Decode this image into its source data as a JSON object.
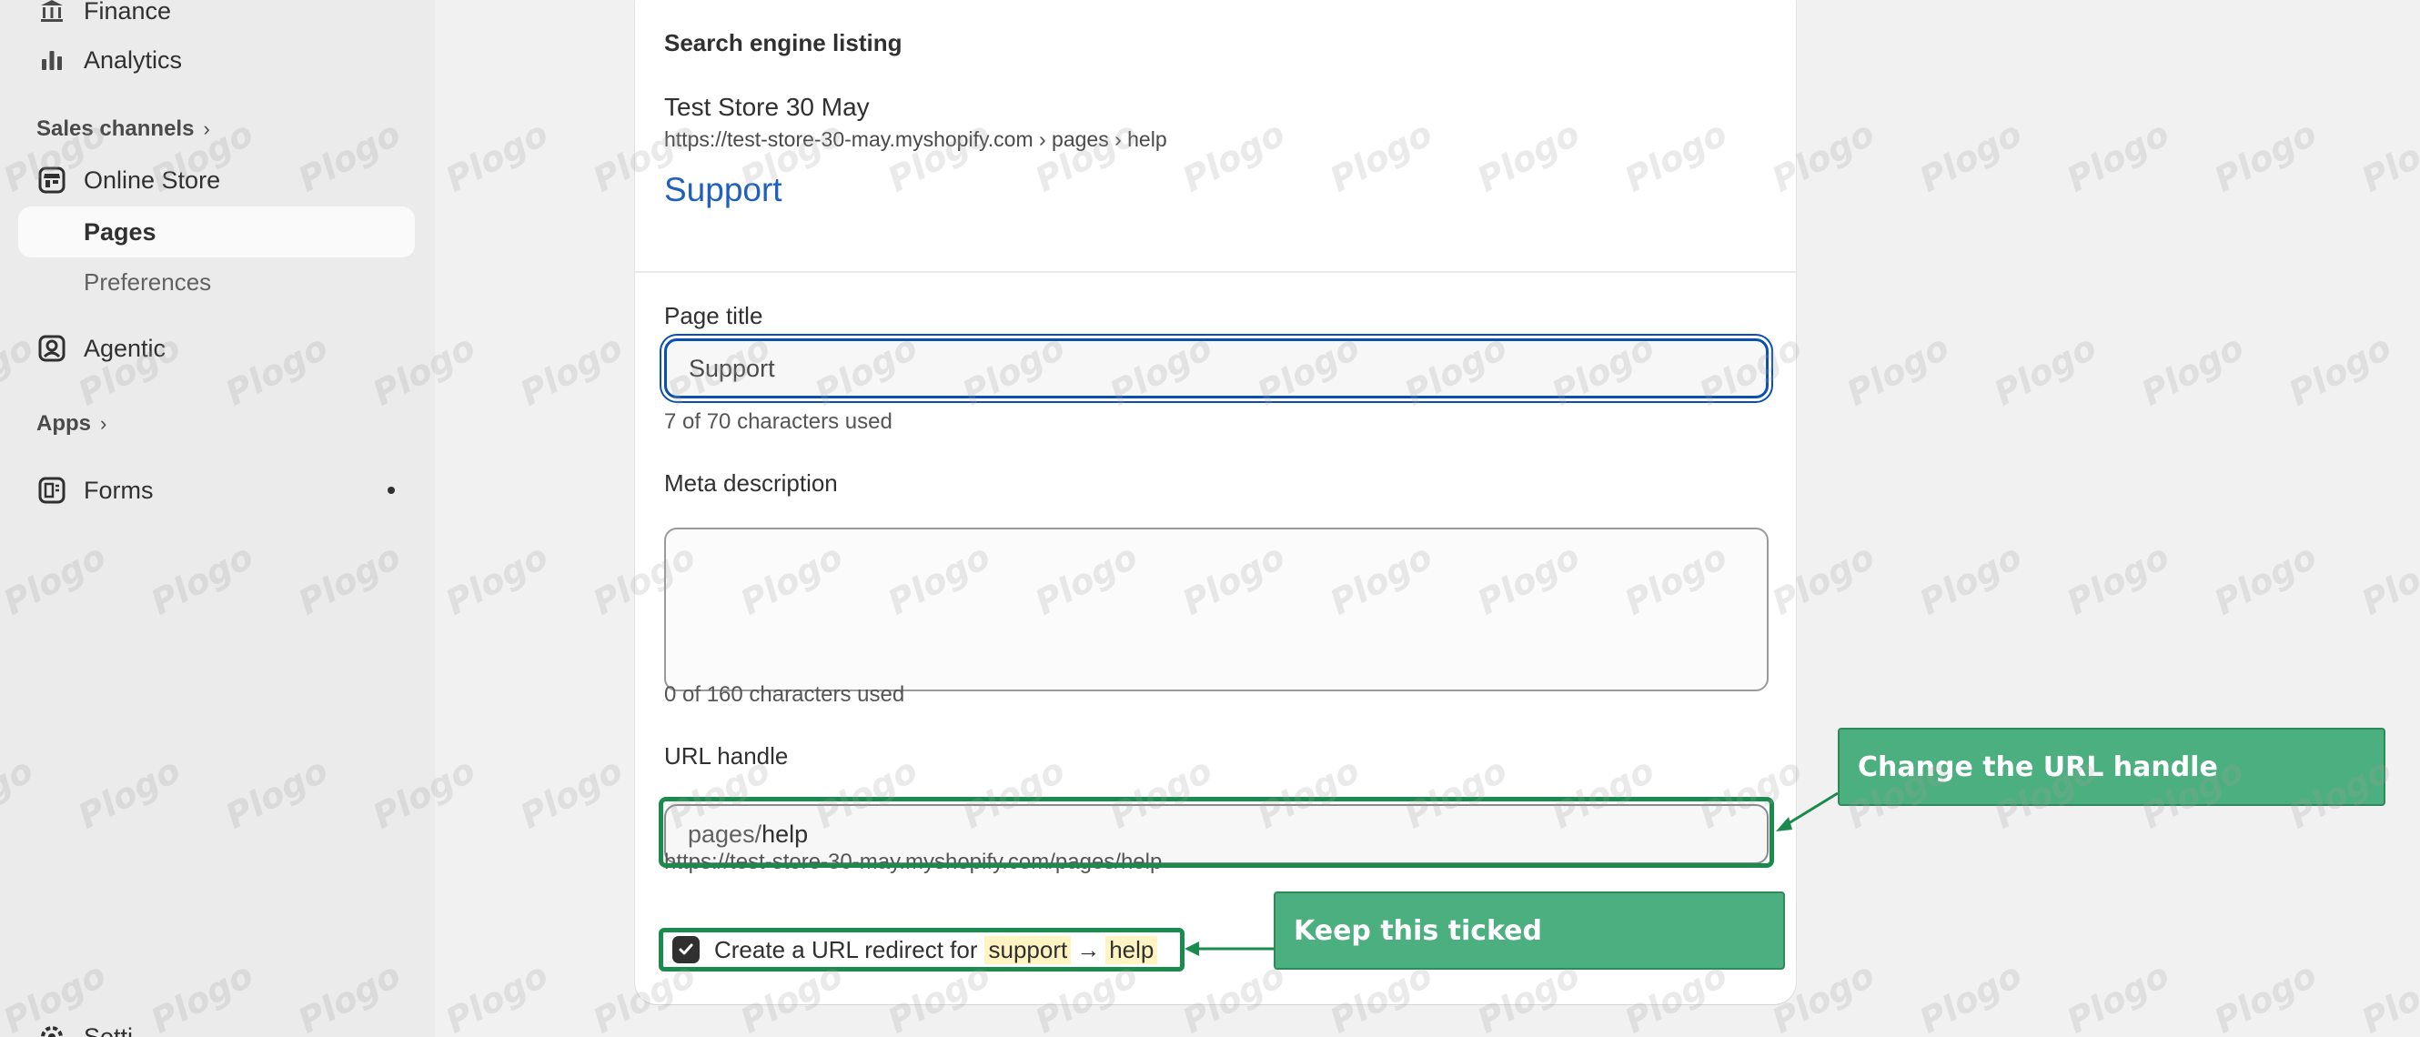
{
  "sidebar": {
    "finance": "Finance",
    "analytics": "Analytics",
    "sales_channels": "Sales channels",
    "online_store": "Online Store",
    "pages": "Pages",
    "preferences": "Preferences",
    "agentic": "Agentic",
    "apps": "Apps",
    "forms": "Forms",
    "settings": "Setti"
  },
  "seo": {
    "card_title": "Search engine listing",
    "store_name": "Test Store 30 May",
    "preview_url": "https://test-store-30-may.myshopify.com › pages › help",
    "preview_title": "Support"
  },
  "page_title": {
    "label": "Page title",
    "value": "Support",
    "help": "7 of 70 characters used"
  },
  "meta_description": {
    "label": "Meta description",
    "value": "",
    "help": "0 of 160 characters used"
  },
  "url_handle": {
    "label": "URL handle",
    "prefix": "pages/",
    "value": "help",
    "help": "https://test-store-30-may.myshopify.com/pages/help"
  },
  "redirect": {
    "checked": true,
    "label": "Create a URL redirect for",
    "from": "support",
    "arrow": "→",
    "to": "help"
  },
  "callouts": {
    "url_handle": "Change the URL handle",
    "keep_ticked": "Keep this ticked"
  },
  "watermark": "Plogo",
  "colors": {
    "accent_blue": "#1f5fbf",
    "focus_blue": "#0b4fb0",
    "callout_green": "#4caf7f",
    "highlight_green": "#1b8a4d"
  }
}
